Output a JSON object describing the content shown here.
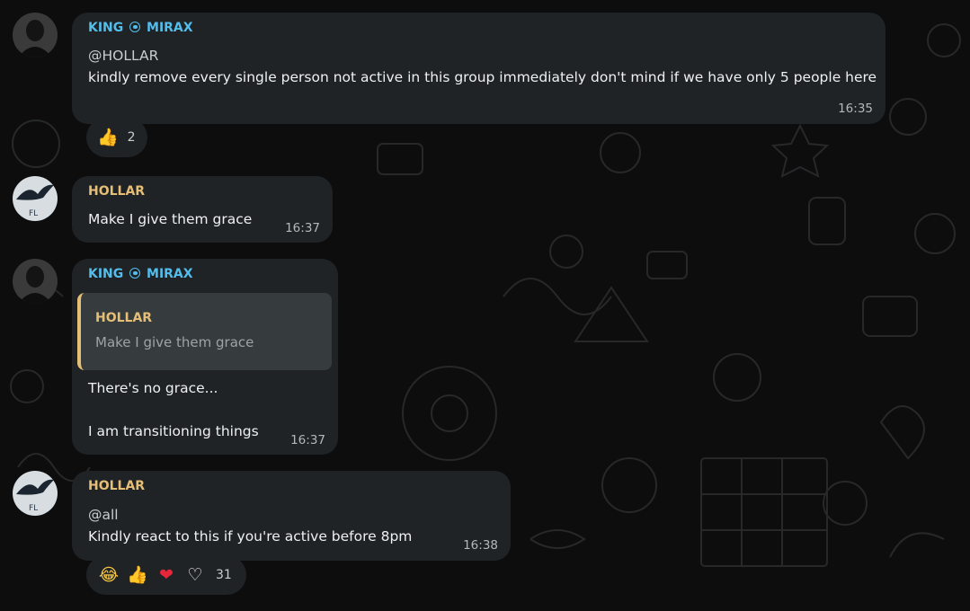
{
  "messages": [
    {
      "sender": "KING",
      "sender_suffix": "MIRAX",
      "mention": "@HOLLAR",
      "text": "kindly remove every single person not active in this group immediately don't mind if we have only 5 people here",
      "time": "16:35",
      "reactions": [
        {
          "icon": "thumbs-up",
          "glyph": "👍"
        }
      ],
      "reaction_count": "2"
    },
    {
      "sender": "HOLLAR",
      "text": "Make I give them grace",
      "time": "16:37"
    },
    {
      "sender": "KING",
      "sender_suffix": "MIRAX",
      "quote": {
        "sender": "HOLLAR",
        "text": "Make I give them grace"
      },
      "text_line1": "There's no grace...",
      "text_line2": "I am transitioning things",
      "time": "16:37"
    },
    {
      "sender": "HOLLAR",
      "mention": "@all",
      "text": "Kindly react to this if you're active before 8pm",
      "time": "16:38",
      "reactions": [
        {
          "icon": "laughing-face",
          "glyph": "😂"
        },
        {
          "icon": "thumbs-up",
          "glyph": "👍"
        },
        {
          "icon": "red-heart",
          "glyph": "❤"
        },
        {
          "icon": "white-heart",
          "glyph": "♡"
        }
      ],
      "reaction_count": "31"
    }
  ],
  "colors": {
    "background": "#0d0d0e",
    "bubble": "#1f2326",
    "sender_king": "#53bdeb",
    "sender_hollar": "#e6bf76",
    "quote_bar": "#e6bf76"
  }
}
